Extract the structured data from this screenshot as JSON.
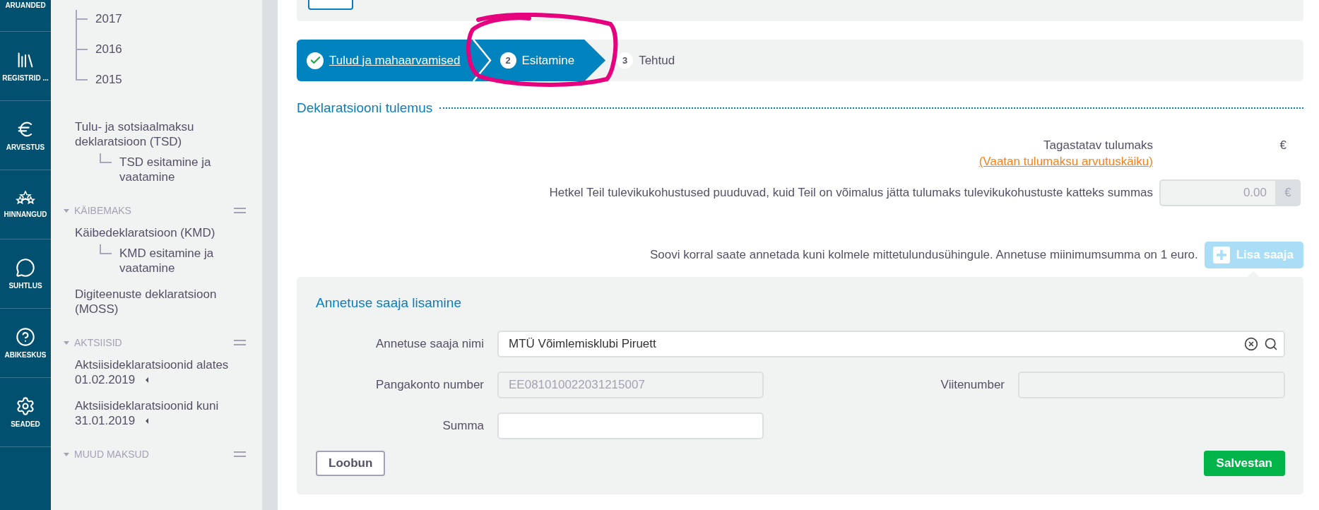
{
  "nav": [
    {
      "label": "ARUANDED"
    },
    {
      "label": "REGISTRID ..."
    },
    {
      "label": "ARVESTUS"
    },
    {
      "label": "HINNANGUD"
    },
    {
      "label": "SUHTLUS"
    },
    {
      "label": "ABIKESKUS"
    },
    {
      "label": "SEADED"
    }
  ],
  "sidebar": {
    "loose_children": [
      {
        "label": "2017"
      },
      {
        "label": "2016"
      },
      {
        "label": "2015"
      }
    ],
    "groups": [
      {
        "items": [
          {
            "label": "Tulu- ja sotsiaalmaksu deklaratsioon (TSD)",
            "children": [
              {
                "label": "TSD esitamine ja vaatamine"
              }
            ]
          }
        ]
      },
      {
        "title": "KÄIBEMAKS",
        "expanded": true,
        "items": [
          {
            "label": "Käibedeklaratsioon (KMD)",
            "children": [
              {
                "label": "KMD esitamine ja vaatamine"
              }
            ]
          },
          {
            "label": "Digiteenuste deklaratsioon (MOSS)"
          }
        ]
      },
      {
        "title": "AKTSIISID",
        "expanded": true,
        "items": [
          {
            "label": "Aktsiisideklaratsioonid alates 01.02.2019",
            "expanded": false
          },
          {
            "label": "Aktsiisideklaratsioonid kuni 31.01.2019",
            "expanded": false
          }
        ]
      },
      {
        "title": "MUUD MAKSUD",
        "expanded": true
      }
    ]
  },
  "steps": [
    {
      "label": "Tulud ja mahaarvamised",
      "done": true,
      "selected": false
    },
    {
      "number": "2",
      "label": "Esitamine",
      "done": false,
      "selected": true
    },
    {
      "number": "3",
      "label": "Tehtud",
      "done": false,
      "selected": false
    }
  ],
  "result": {
    "title": "Deklaratsiooni tulemus",
    "rows": [
      {
        "kind": "amount",
        "label": "Tagastatav tulumaks",
        "value": "€"
      },
      {
        "kind": "link",
        "label": "(Vaatan tulumaksu arvutuskäiku)"
      },
      {
        "kind": "input",
        "label": "Hetkel Teil tulevikukohustused puuduvad, kuid Teil on võimalus jätta tulumaks tulevikukohustuste katteks summas",
        "value": "0.00",
        "unit": "€",
        "disabled": true
      }
    ]
  },
  "donation": {
    "note": "Soovi korral saate annetada kuni kolmele mittetulundusühingule. Annetuse miinimumsumma on 1 euro.",
    "add_button": {
      "label": "Lisa saaja",
      "disabled": true
    }
  },
  "panel": {
    "title": "Annetuse saaja lisamine",
    "fields": [
      {
        "kind": "search",
        "label": "Annetuse saaja nimi",
        "value": "MTÜ Võimlemisklubi Piruett",
        "disabled": false
      },
      {
        "kind": "text",
        "label": "Pangakonto number",
        "value": "EE081010022031215007",
        "disabled": true
      },
      {
        "kind": "text",
        "label": "Viitenumber",
        "disabled": true
      },
      {
        "kind": "text",
        "label": "Summa",
        "disabled": false
      }
    ],
    "buttons": [
      {
        "kind": "secondary",
        "label": "Loobun"
      },
      {
        "kind": "primary",
        "label": "Salvestan"
      }
    ]
  }
}
